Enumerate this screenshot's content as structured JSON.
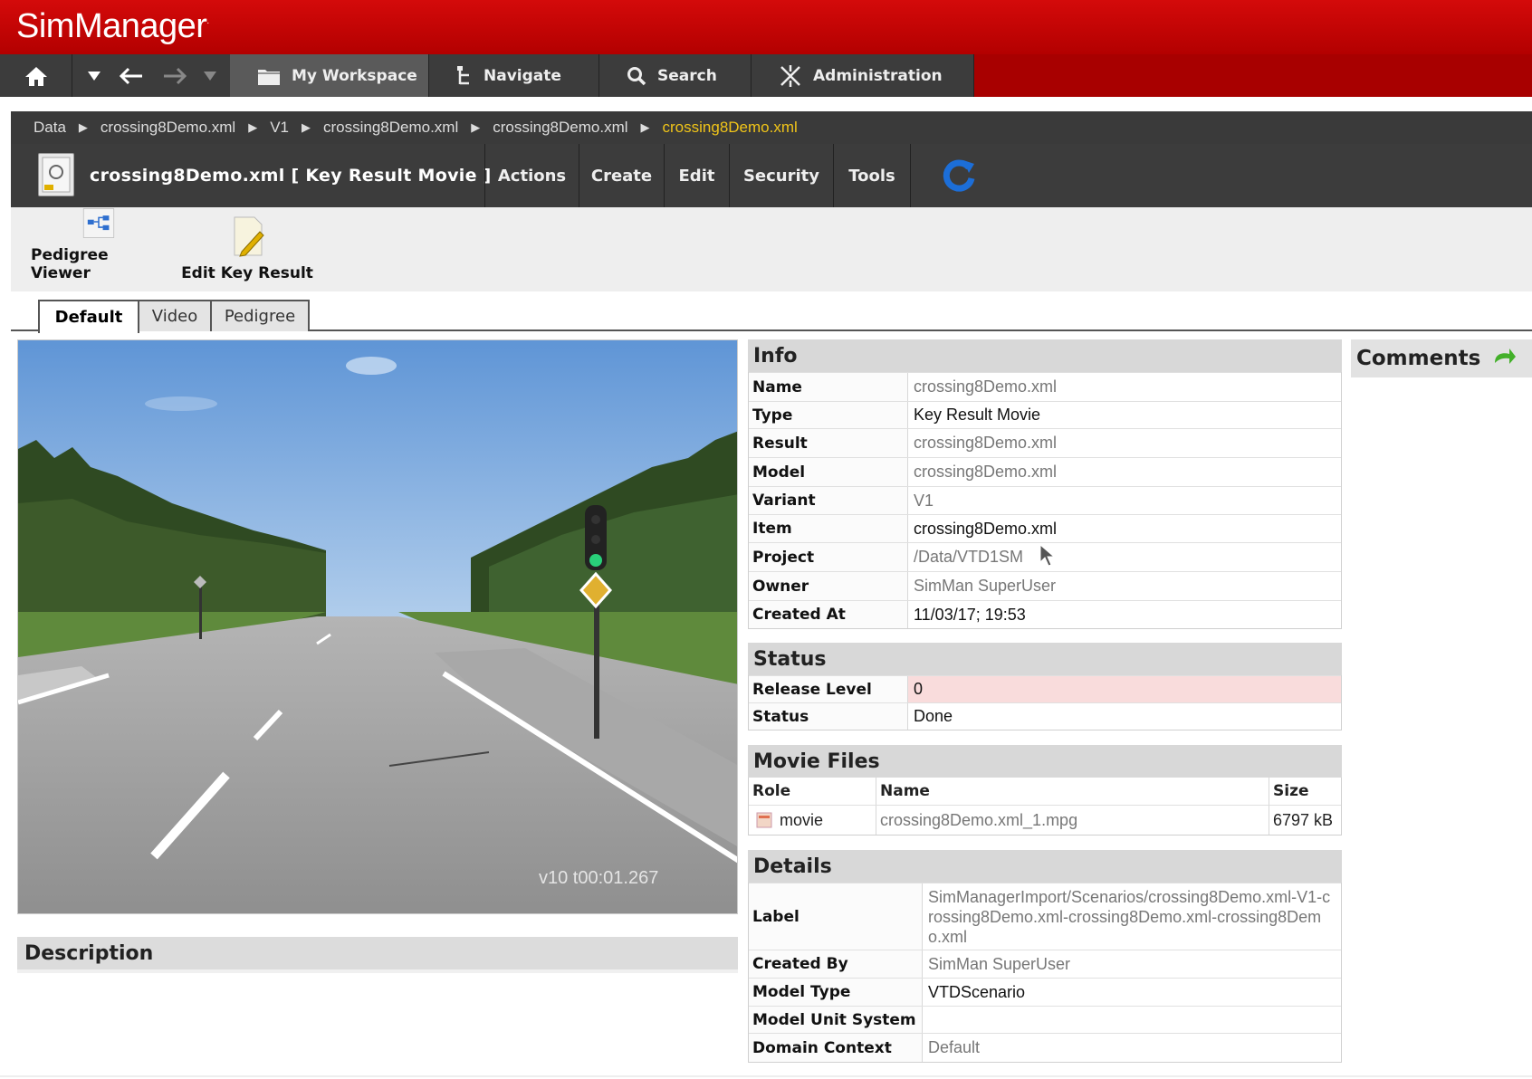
{
  "app": {
    "name": "SimManager",
    "trademark": "."
  },
  "nav": {
    "tabs": [
      {
        "label": "My Workspace",
        "icon": "folder-icon"
      },
      {
        "label": "Navigate",
        "icon": "tree-icon"
      },
      {
        "label": "Search",
        "icon": "search-icon"
      },
      {
        "label": "Administration",
        "icon": "tools-icon"
      }
    ]
  },
  "breadcrumb": [
    "Data",
    "crossing8Demo.xml",
    "V1",
    "crossing8Demo.xml",
    "crossing8Demo.xml",
    "crossing8Demo.xml"
  ],
  "object": {
    "title": "crossing8Demo.xml [ Key Result Movie ]",
    "menu": [
      "Actions",
      "Create",
      "Edit",
      "Security",
      "Tools"
    ]
  },
  "toolbar": {
    "pedigree_viewer": "Pedigree Viewer",
    "edit_key_result": "Edit Key Result"
  },
  "tabs": [
    "Default",
    "Video",
    "Pedigree"
  ],
  "video": {
    "timestamp": "v10 t00:01.267"
  },
  "description": {
    "title": "Description"
  },
  "info": {
    "title": "Info",
    "rows": [
      {
        "key": "Name",
        "value": "crossing8Demo.xml"
      },
      {
        "key": "Type",
        "value": "Key Result Movie"
      },
      {
        "key": "Result",
        "value": "crossing8Demo.xml"
      },
      {
        "key": "Model",
        "value": "crossing8Demo.xml"
      },
      {
        "key": "Variant",
        "value": "V1"
      },
      {
        "key": "Item",
        "value": "crossing8Demo.xml"
      },
      {
        "key": "Project",
        "value": "/Data/VTD1SM"
      },
      {
        "key": "Owner",
        "value": "SimMan SuperUser"
      },
      {
        "key": "Created At",
        "value": "11/03/17; 19:53"
      }
    ]
  },
  "status": {
    "title": "Status",
    "rows": [
      {
        "key": "Release Level",
        "value": "0"
      },
      {
        "key": "Status",
        "value": "Done"
      }
    ]
  },
  "movie_files": {
    "title": "Movie Files",
    "columns": [
      "Role",
      "Name",
      "Size"
    ],
    "rows": [
      {
        "role": "movie",
        "name": "crossing8Demo.xml_1.mpg",
        "size": "6797 kB"
      }
    ]
  },
  "details": {
    "title": "Details",
    "rows": [
      {
        "key": "Label",
        "value": "SimManagerImport/Scenarios/crossing8Demo.xml-V1-crossing8Demo.xml-crossing8Demo.xml-crossing8Demo.xml"
      },
      {
        "key": "Created By",
        "value": "SimMan SuperUser"
      },
      {
        "key": "Model Type",
        "value": "VTDScenario"
      },
      {
        "key": "Model Unit System",
        "value": ""
      },
      {
        "key": "Domain Context",
        "value": "Default"
      }
    ]
  },
  "comments": {
    "title": "Comments"
  },
  "colors": {
    "brand_red": "#c40000",
    "dark_bar": "#3c3c3c",
    "breadcrumb_current": "#f0c419",
    "release_bg": "#f9dcdc"
  }
}
